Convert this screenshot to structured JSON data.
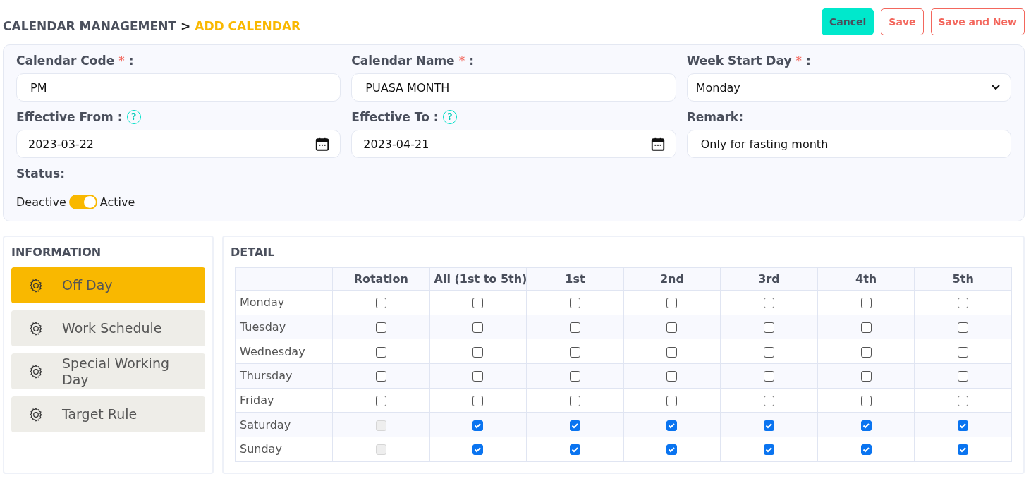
{
  "breadcrumb": {
    "parent": "CALENDAR MANAGEMENT",
    "separator": ">",
    "current": "ADD CALENDAR"
  },
  "actions": [
    {
      "label": "Cancel",
      "kind": "primary"
    },
    {
      "label": "Save",
      "kind": "outline"
    },
    {
      "label": "Save and New",
      "kind": "outline"
    }
  ],
  "form": {
    "fields": [
      {
        "label": "Calendar Code",
        "required_mark": "*",
        "colon": ":",
        "kind": "text",
        "value": "PM"
      },
      {
        "label": "Calendar Name",
        "required_mark": "*",
        "colon": ":",
        "kind": "text",
        "value": "PUASA MONTH"
      },
      {
        "label": "Week Start Day",
        "required_mark": "*",
        "colon": ":",
        "kind": "select",
        "value": "Monday"
      },
      {
        "label": "Effective From",
        "colon": ":",
        "help": "?",
        "kind": "date",
        "value": "2023-03-22"
      },
      {
        "label": "Effective To",
        "colon": ":",
        "help": "?",
        "kind": "date",
        "value": "2023-04-21"
      },
      {
        "label": "Remark:",
        "kind": "text",
        "value": "Only for fasting month"
      }
    ],
    "status": {
      "label": "Status:",
      "off_label": "Deactive",
      "on_label": "Active",
      "on": true
    }
  },
  "information": {
    "title": "INFORMATION",
    "items": [
      {
        "label": "Off Day",
        "selected": true
      },
      {
        "label": "Work Schedule",
        "selected": false
      },
      {
        "label": "Special Working Day",
        "selected": false
      },
      {
        "label": "Target Rule",
        "selected": false
      }
    ]
  },
  "detail": {
    "title": "DETAIL",
    "columns": [
      "Rotation",
      "All (1st to 5th)",
      "1st",
      "2nd",
      "3rd",
      "4th",
      "5th"
    ],
    "rows": [
      {
        "day": "Monday",
        "cells": [
          {
            "checked": false,
            "disabled": false
          },
          {
            "checked": false,
            "disabled": false
          },
          {
            "checked": false,
            "disabled": false
          },
          {
            "checked": false,
            "disabled": false
          },
          {
            "checked": false,
            "disabled": false
          },
          {
            "checked": false,
            "disabled": false
          },
          {
            "checked": false,
            "disabled": false
          }
        ]
      },
      {
        "day": "Tuesday",
        "cells": [
          {
            "checked": false,
            "disabled": false
          },
          {
            "checked": false,
            "disabled": false
          },
          {
            "checked": false,
            "disabled": false
          },
          {
            "checked": false,
            "disabled": false
          },
          {
            "checked": false,
            "disabled": false
          },
          {
            "checked": false,
            "disabled": false
          },
          {
            "checked": false,
            "disabled": false
          }
        ]
      },
      {
        "day": "Wednesday",
        "cells": [
          {
            "checked": false,
            "disabled": false
          },
          {
            "checked": false,
            "disabled": false
          },
          {
            "checked": false,
            "disabled": false
          },
          {
            "checked": false,
            "disabled": false
          },
          {
            "checked": false,
            "disabled": false
          },
          {
            "checked": false,
            "disabled": false
          },
          {
            "checked": false,
            "disabled": false
          }
        ]
      },
      {
        "day": "Thursday",
        "cells": [
          {
            "checked": false,
            "disabled": false
          },
          {
            "checked": false,
            "disabled": false
          },
          {
            "checked": false,
            "disabled": false
          },
          {
            "checked": false,
            "disabled": false
          },
          {
            "checked": false,
            "disabled": false
          },
          {
            "checked": false,
            "disabled": false
          },
          {
            "checked": false,
            "disabled": false
          }
        ]
      },
      {
        "day": "Friday",
        "cells": [
          {
            "checked": false,
            "disabled": false
          },
          {
            "checked": false,
            "disabled": false
          },
          {
            "checked": false,
            "disabled": false
          },
          {
            "checked": false,
            "disabled": false
          },
          {
            "checked": false,
            "disabled": false
          },
          {
            "checked": false,
            "disabled": false
          },
          {
            "checked": false,
            "disabled": false
          }
        ]
      },
      {
        "day": "Saturday",
        "cells": [
          {
            "checked": false,
            "disabled": true
          },
          {
            "checked": true,
            "disabled": false
          },
          {
            "checked": true,
            "disabled": false
          },
          {
            "checked": true,
            "disabled": false
          },
          {
            "checked": true,
            "disabled": false
          },
          {
            "checked": true,
            "disabled": false
          },
          {
            "checked": true,
            "disabled": false
          }
        ]
      },
      {
        "day": "Sunday",
        "cells": [
          {
            "checked": false,
            "disabled": true
          },
          {
            "checked": true,
            "disabled": false
          },
          {
            "checked": true,
            "disabled": false
          },
          {
            "checked": true,
            "disabled": false
          },
          {
            "checked": true,
            "disabled": false
          },
          {
            "checked": true,
            "disabled": false
          },
          {
            "checked": true,
            "disabled": false
          }
        ]
      }
    ]
  }
}
